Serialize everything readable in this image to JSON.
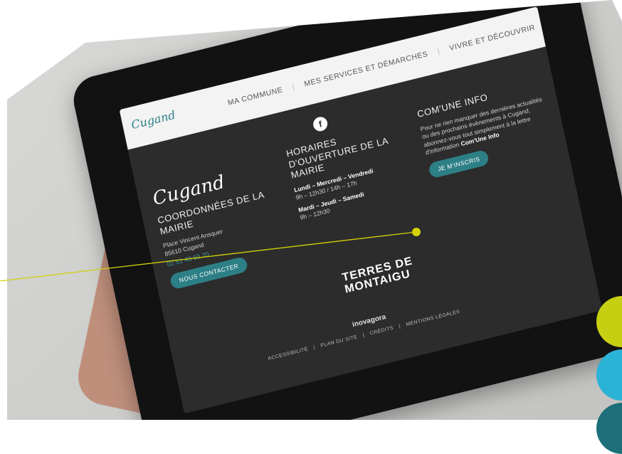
{
  "nav": {
    "logo": "Cugand",
    "items": [
      "MA COMMUNE",
      "MES SERVICES ET DÉMARCHES",
      "VIVRE ET DÉCOUVRIR"
    ]
  },
  "col1": {
    "logo_big": "Cugand",
    "title": "COORDONNÉES DE LA MAIRIE",
    "address1": "Place Vincent Ansquer",
    "address2": "85610 Cugand",
    "phone": "02 51 43 60 70",
    "button": "NOUS CONTACTER"
  },
  "col2": {
    "title": "HORAIRES D'OUVERTURE DE LA MAIRIE",
    "days1": "Lundi – Mercredi – Vendredi",
    "hours1": "9h – 12h30 / 14h – 17h",
    "days2": "Mardi – Jeudi – Samedi",
    "hours2": "9h – 12h30"
  },
  "col3": {
    "title": "COM'UNE INFO",
    "text": "Pour ne rien manquer des dernières actualités ou des prochains évènements à Cugand, abonnez-vous tout simplement à la lettre d'information",
    "text_bold": "Com'Une Info",
    "button": "JE M'INSCRIS"
  },
  "terres": [
    "TERRES DE",
    "MONTAIGU"
  ],
  "footer": {
    "links": [
      "ACCESSIBILITÉ",
      "PLAN DU SITE",
      "CRÉDITS",
      "MENTIONS LÉGALES"
    ],
    "agency": "inovagora"
  },
  "icons": {
    "social": "facebook-icon"
  },
  "colors": {
    "accent": "#2d7f86",
    "dot1": "#c7cf12",
    "dot2": "#2ab3d6",
    "dot3": "#1d6f7a"
  }
}
